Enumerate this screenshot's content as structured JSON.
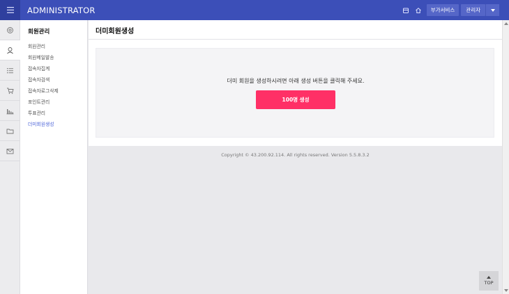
{
  "header": {
    "brand": "ADMINISTRATOR",
    "addon_label": "부가서비스",
    "admin_label": "관리자"
  },
  "rail": {
    "icons": [
      "settings-icon",
      "member-icon",
      "list-icon",
      "cart-icon",
      "chart-icon",
      "folder-icon",
      "mail-icon"
    ],
    "active_index": 1
  },
  "submenu": {
    "title": "회원관리",
    "items": [
      "회원관리",
      "회원메일발송",
      "접속자집계",
      "접속자검색",
      "접속자로그삭제",
      "포인트관리",
      "투표관리",
      "더미회원생성"
    ],
    "current_index": 7
  },
  "main": {
    "page_title": "더미회원생성",
    "instruction": "더미 회원을 생성하시려면 아래 생성 버튼을 클릭해 주세요.",
    "create_button": "100명 생성"
  },
  "footer": {
    "copyright": "Copyright © 43.200.92.114. All rights reserved. Version 5.5.8.3.2",
    "top_button": "TOP"
  },
  "colors": {
    "topbar": "#3c4fb8",
    "accent_button": "#ff3066",
    "active_link": "#4a62d8"
  }
}
